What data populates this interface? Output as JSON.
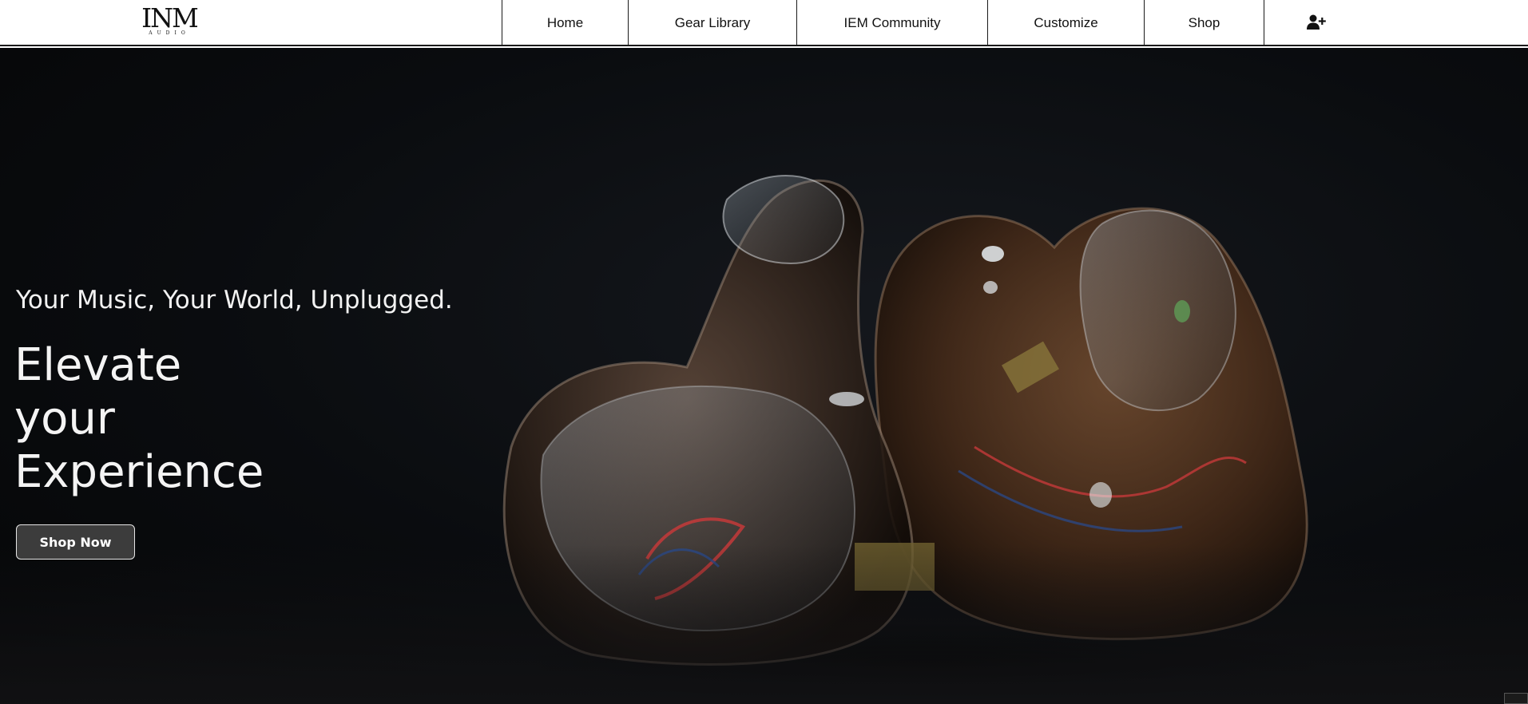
{
  "brand": {
    "logo_text": "INM",
    "logo_subtext": "AUDIO"
  },
  "nav": {
    "items": [
      {
        "label": "Home"
      },
      {
        "label": "Gear Library"
      },
      {
        "label": "IEM Community"
      },
      {
        "label": "Customize"
      },
      {
        "label": "Shop"
      }
    ],
    "signup_icon": "user-plus-icon"
  },
  "hero": {
    "tagline": "Your Music, Your World, Unplugged.",
    "headline_lines": [
      "Elevate",
      "your",
      "Experience"
    ],
    "cta_label": "Shop Now",
    "image_subject": "custom-in-ear-monitors-photo"
  },
  "colors": {
    "nav_background": "#ffffff",
    "nav_border": "#1a1a1a",
    "hero_background": "#0a0c0f",
    "hero_text": "#f4f4f4",
    "cta_background": "#3c3c3c",
    "cta_border": "#e6e6e6"
  }
}
